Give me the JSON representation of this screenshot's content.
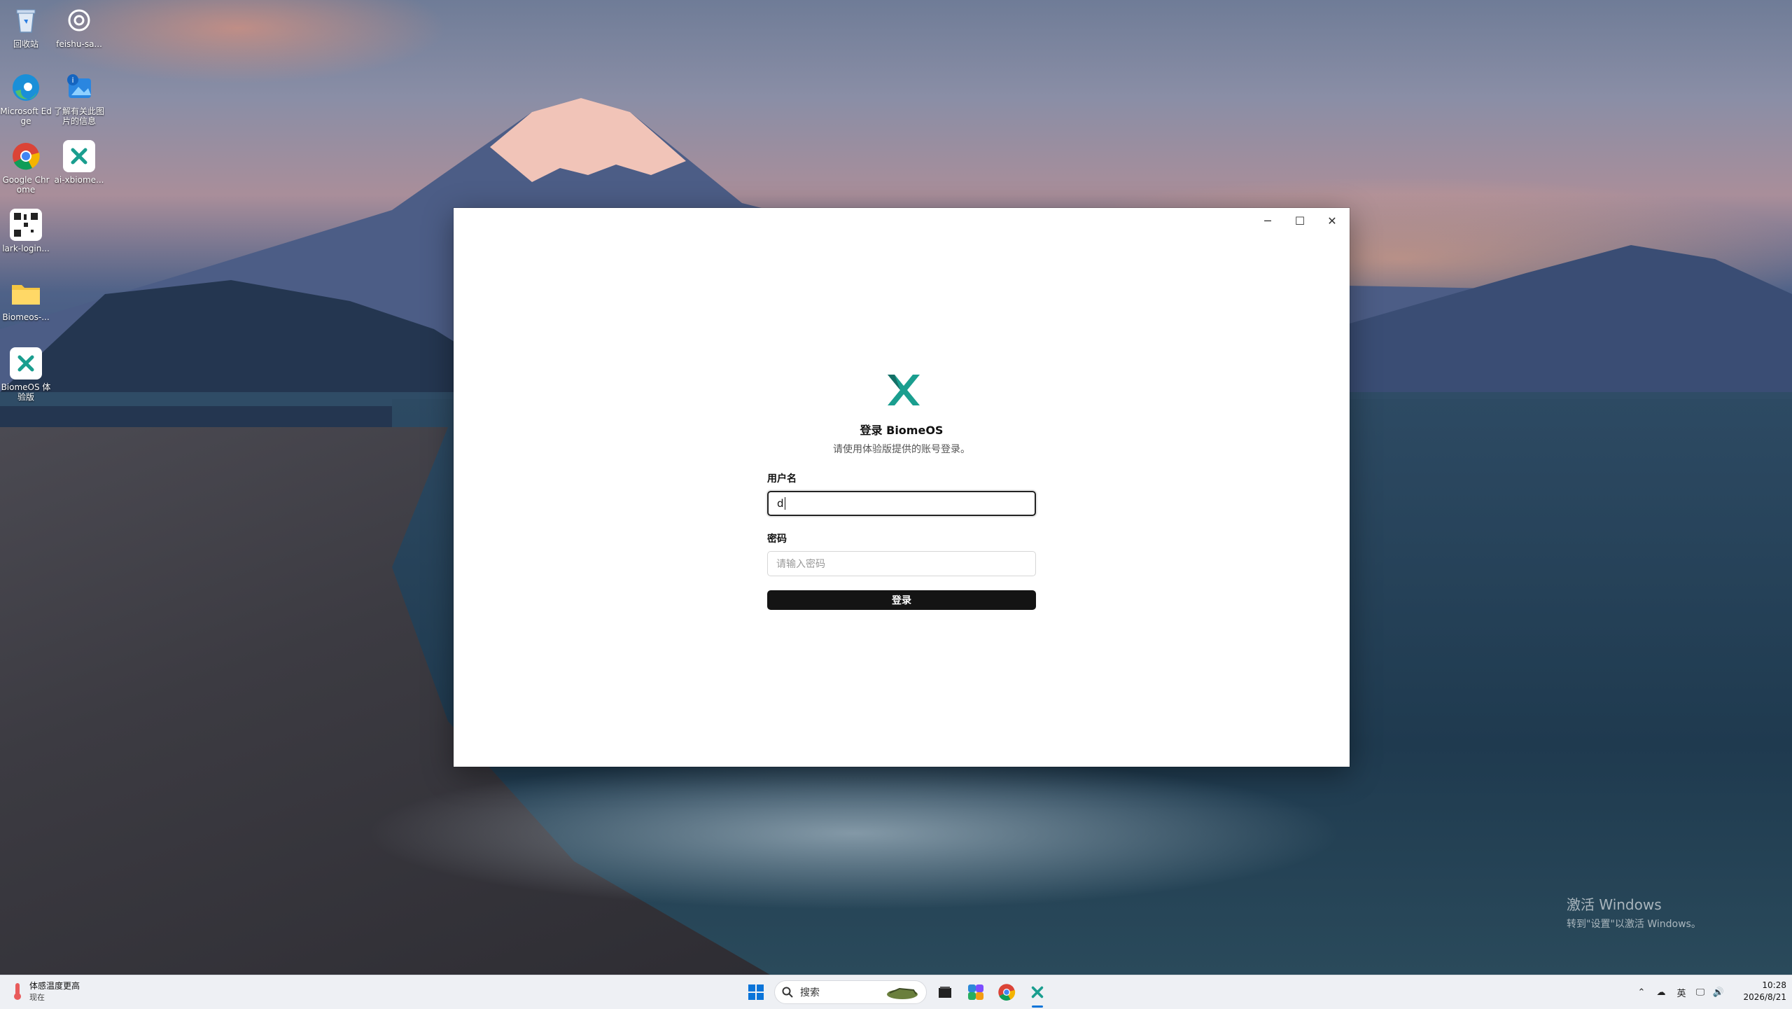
{
  "desktop": {
    "icons": [
      {
        "label": "回收站",
        "icon": "recycle-bin-icon"
      },
      {
        "label": "feishu-sa...",
        "icon": "openai-icon"
      },
      {
        "label": "Microsoft Edge",
        "icon": "edge-icon"
      },
      {
        "label": "了解有关此图片的信息",
        "icon": "info-icon"
      },
      {
        "label": "Google Chrome",
        "icon": "chrome-icon"
      },
      {
        "label": "ai-xbiome...",
        "icon": "x-logo-icon"
      },
      {
        "label": "lark-login...",
        "icon": "qr-code-icon"
      },
      {
        "label": "Biomeos-...",
        "icon": "folder-icon"
      },
      {
        "label": "BiomeOS 体验版",
        "icon": "x-logo-icon"
      }
    ],
    "watermark": {
      "line1": "激活 Windows",
      "line2": "转到\"设置\"以激活 Windows。"
    }
  },
  "window": {
    "controls": {
      "minimize": "─",
      "maximize": "☐",
      "close": "✕"
    },
    "title": "登录 BiomeOS",
    "subtitle": "请使用体验版提供的账号登录。",
    "username": {
      "label": "用户名",
      "value": "d"
    },
    "password": {
      "label": "密码",
      "placeholder": "请输入密码"
    },
    "login_label": "登录",
    "brand_color": "#1a9e8f"
  },
  "taskbar": {
    "weather": {
      "line1": "体感温度更高",
      "line2": "现在"
    },
    "search": {
      "placeholder": "搜索"
    },
    "tray": {
      "ime": "英"
    },
    "clock": {
      "time": "10:28",
      "date": "2026/8/21"
    }
  }
}
